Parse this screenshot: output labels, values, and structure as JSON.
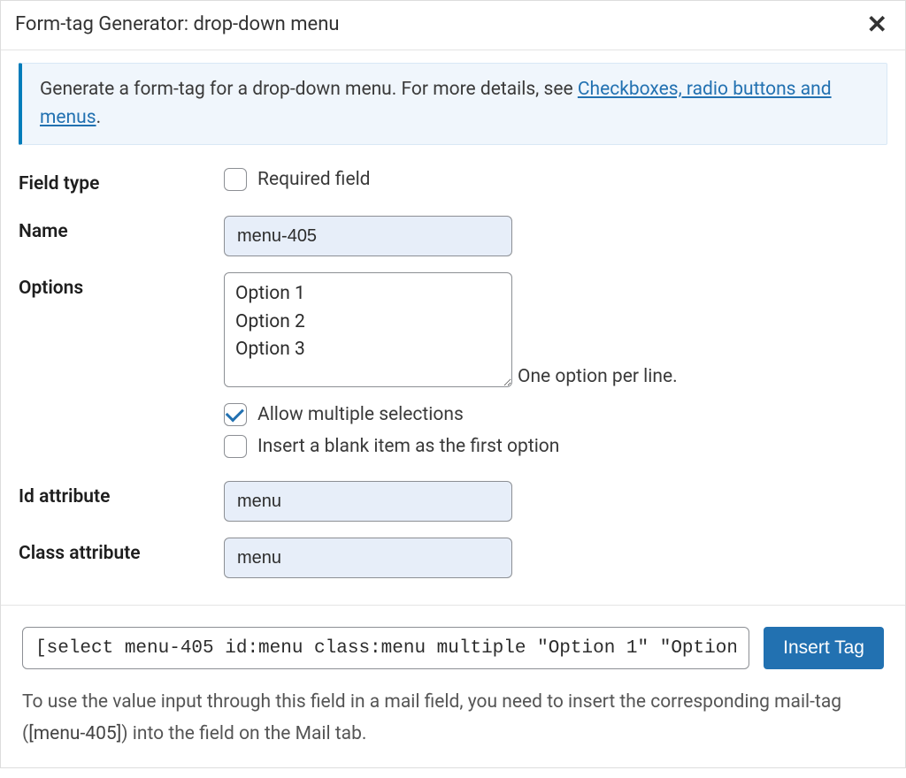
{
  "title": "Form-tag Generator: drop-down menu",
  "info": {
    "before_link": "Generate a form-tag for a drop-down menu. For more details, see ",
    "link_text": "Checkboxes, radio buttons and menus",
    "after_link": "."
  },
  "labels": {
    "field_type": "Field type",
    "name": "Name",
    "options": "Options",
    "id_attr": "Id attribute",
    "class_attr": "Class attribute"
  },
  "checkboxes": {
    "required": "Required field",
    "multiple": "Allow multiple selections",
    "blank_first": "Insert a blank item as the first option"
  },
  "values": {
    "name": "menu-405",
    "options_text": "Option 1\nOption 2\nOption 3",
    "id": "menu",
    "class": "menu"
  },
  "hints": {
    "per_line": "One option per line."
  },
  "footer": {
    "generated_tag": "[select menu-405 id:menu class:menu multiple \"Option 1\" \"Option",
    "insert_label": "Insert Tag",
    "mail_before": "To use the value input through this field in a mail field, you need to insert the corresponding mail-tag (",
    "mail_tag": "[menu-405]",
    "mail_after": ") into the field on the Mail tab."
  }
}
